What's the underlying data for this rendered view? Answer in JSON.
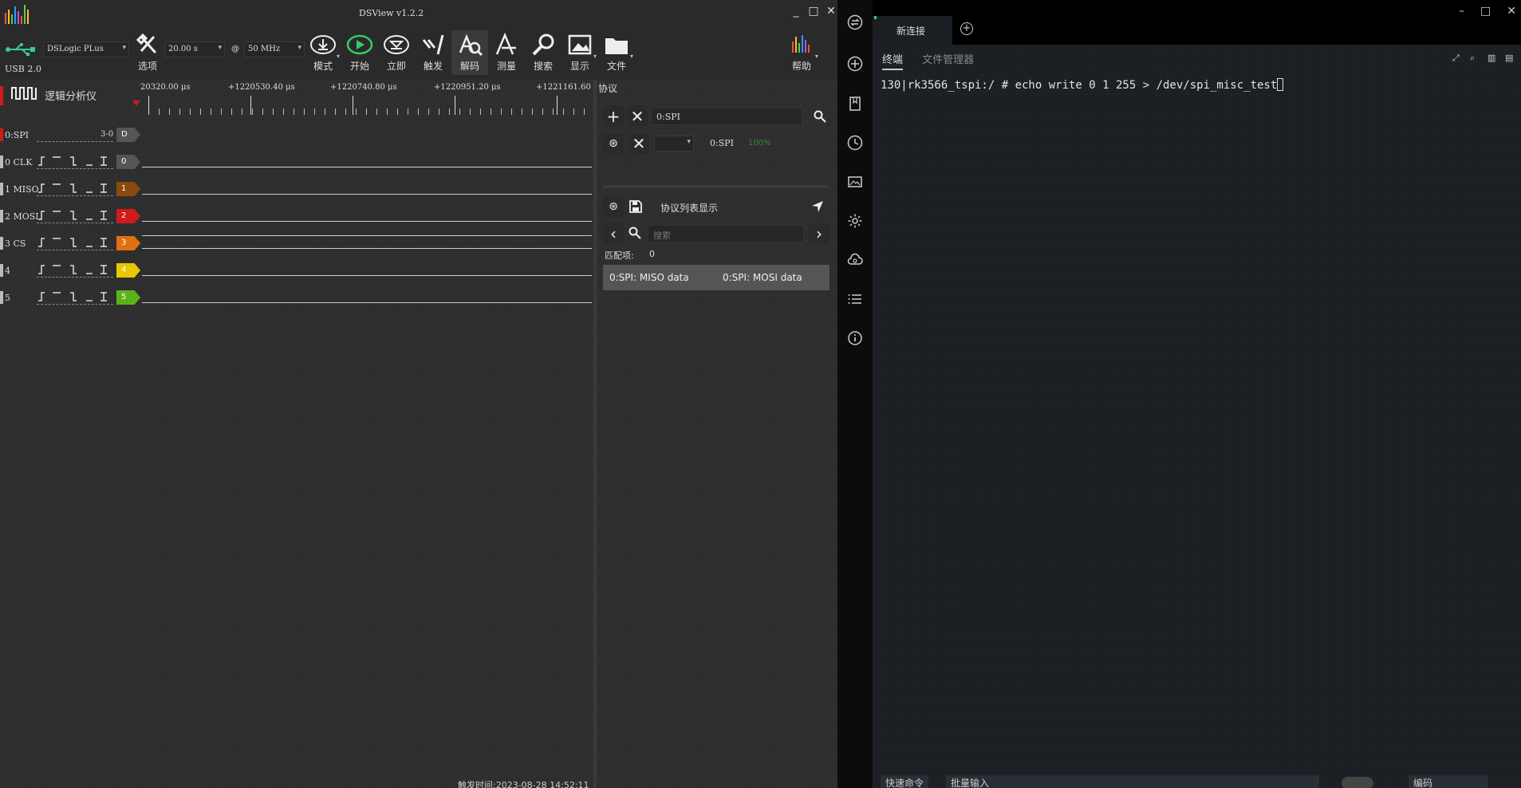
{
  "dsview": {
    "title": "DSView v1.2.2",
    "usb_label": "USB 2.0",
    "device": "DSLogic PLus",
    "duration": "20.00 s",
    "at": "@",
    "rate": "50 MHz",
    "toolbar": [
      {
        "key": "options",
        "label": "选项"
      },
      {
        "key": "mode",
        "label": "模式"
      },
      {
        "key": "start",
        "label": "开始"
      },
      {
        "key": "instant",
        "label": "立即"
      },
      {
        "key": "trigger",
        "label": "触发"
      },
      {
        "key": "decode",
        "label": "解码"
      },
      {
        "key": "measure",
        "label": "测量"
      },
      {
        "key": "search",
        "label": "搜索"
      },
      {
        "key": "display",
        "label": "显示"
      },
      {
        "key": "file",
        "label": "文件"
      },
      {
        "key": "help",
        "label": "帮助"
      }
    ],
    "analyzer_label": "逻辑分析仪",
    "ruler_labels": [
      "20320.00 μs",
      "+1220530.40 μs",
      "+1220740.80 μs",
      "+1220951.20 μs",
      "+1221161.60 μs"
    ],
    "channels": [
      {
        "name": "0:SPI",
        "range": "3-0",
        "tag": "D",
        "color": "#555555"
      },
      {
        "name": "0 CLK",
        "tag": "0",
        "color": "#555555"
      },
      {
        "name": "1 MISO",
        "tag": "1",
        "color": "#8a4a0e"
      },
      {
        "name": "2 MOSI",
        "tag": "2",
        "color": "#d01b1b"
      },
      {
        "name": "3 CS",
        "tag": "3",
        "color": "#e07010"
      },
      {
        "name": "4",
        "tag": "4",
        "color": "#e6c800"
      },
      {
        "name": "5",
        "tag": "5",
        "color": "#5bb31a"
      }
    ],
    "trigger_time": "触发时间:2023-08-28 14:52:11",
    "panel": {
      "title": "协议",
      "decoder_field": "0:SPI",
      "decoder_name": "0:SPI",
      "decoder_progress": "100%",
      "list_title": "协议列表显示",
      "search_placeholder": "搜索",
      "match_label": "匹配项:",
      "match_count": "0",
      "row_col1": "0:SPI: MISO data",
      "row_col2": "0:SPI: MOSI data"
    }
  },
  "terminal": {
    "tab_label": "新连接",
    "subtabs": [
      "终端",
      "文件管理器"
    ],
    "prompt": "130|rk3566_tspi:/ # echo write 0 1 255 > /dev/spi_misc_test",
    "bottom": {
      "quick_cmd": "快速命令",
      "batch_input": "批量输入",
      "encoding": "编码"
    }
  },
  "sidebar_icons": [
    "connect-icon",
    "add-circle-icon",
    "bookmark-icon",
    "history-icon",
    "image-icon",
    "settings-icon",
    "cloud-sync-icon",
    "list-icon",
    "info-icon"
  ]
}
